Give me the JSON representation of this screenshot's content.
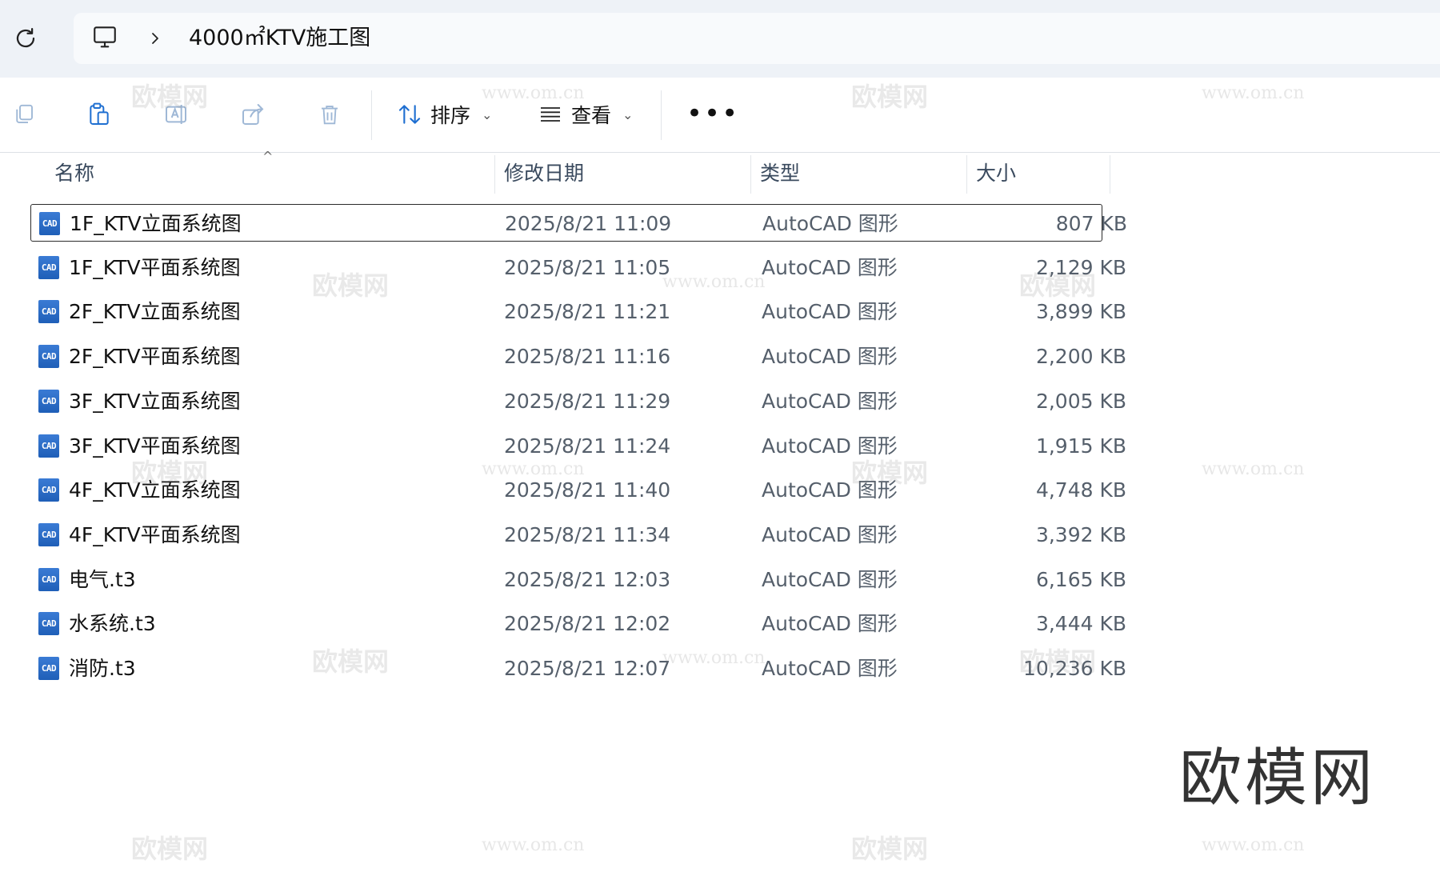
{
  "address": {
    "refresh_icon": "refresh-icon",
    "location_icon": "monitor-icon",
    "breadcrumb": "4000㎡KTV施工图"
  },
  "toolbar": {
    "sort_label": "排序",
    "view_label": "查看",
    "more_label": "•••"
  },
  "columns": {
    "name": "名称",
    "date": "修改日期",
    "type": "类型",
    "size": "大小"
  },
  "files": [
    {
      "name": "1F_KTV立面系统图",
      "date": "2025/8/21 11:09",
      "type": "AutoCAD 图形",
      "size": "807 KB"
    },
    {
      "name": "1F_KTV平面系统图",
      "date": "2025/8/21 11:05",
      "type": "AutoCAD 图形",
      "size": "2,129 KB"
    },
    {
      "name": "2F_KTV立面系统图",
      "date": "2025/8/21 11:21",
      "type": "AutoCAD 图形",
      "size": "3,899 KB"
    },
    {
      "name": "2F_KTV平面系统图",
      "date": "2025/8/21 11:16",
      "type": "AutoCAD 图形",
      "size": "2,200 KB"
    },
    {
      "name": "3F_KTV立面系统图",
      "date": "2025/8/21 11:29",
      "type": "AutoCAD 图形",
      "size": "2,005 KB"
    },
    {
      "name": "3F_KTV平面系统图",
      "date": "2025/8/21 11:24",
      "type": "AutoCAD 图形",
      "size": "1,915 KB"
    },
    {
      "name": "4F_KTV立面系统图",
      "date": "2025/8/21 11:40",
      "type": "AutoCAD 图形",
      "size": "4,748 KB"
    },
    {
      "name": "4F_KTV平面系统图",
      "date": "2025/8/21 11:34",
      "type": "AutoCAD 图形",
      "size": "3,392 KB"
    },
    {
      "name": "电气.t3",
      "date": "2025/8/21 12:03",
      "type": "AutoCAD 图形",
      "size": "6,165 KB"
    },
    {
      "name": "水系统.t3",
      "date": "2025/8/21 12:02",
      "type": "AutoCAD 图形",
      "size": "3,444 KB"
    },
    {
      "name": "消防.t3",
      "date": "2025/8/21 12:07",
      "type": "AutoCAD 图形",
      "size": "10,236 KB"
    }
  ],
  "file_icon_text": "CAD",
  "selected_index": 0,
  "watermark": {
    "logo": "欧模网",
    "url": "www.om.cn"
  },
  "colors": {
    "accent": "#1f6fd1",
    "address_bg": "#eef2f7"
  }
}
